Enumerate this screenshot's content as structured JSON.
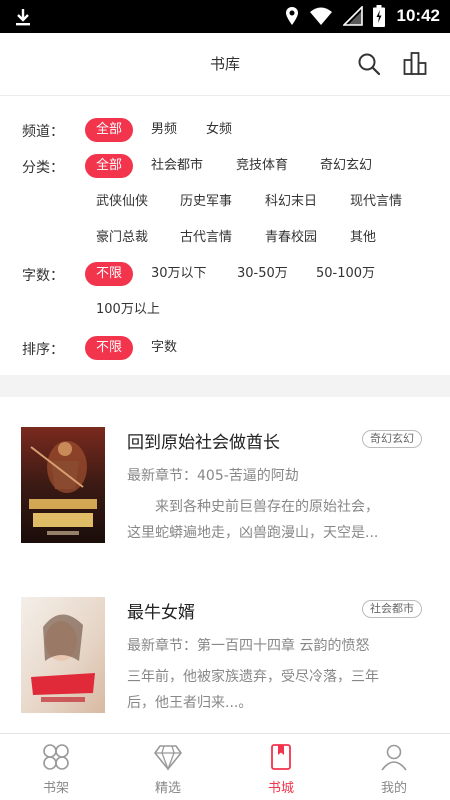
{
  "status_bar": {
    "time": "10:42",
    "icons": [
      "download-icon",
      "location-icon",
      "wifi-icon",
      "signal-icon",
      "battery-icon"
    ]
  },
  "header": {
    "title": "书库",
    "icons": [
      "search-icon",
      "ranking-icon"
    ]
  },
  "filters": {
    "channel": {
      "label": "频道：",
      "options": [
        "全部",
        "男频",
        "女频"
      ],
      "selected": "全部"
    },
    "category": {
      "label": "分类：",
      "options": [
        "全部",
        "社会都市",
        "竞技体育",
        "奇幻玄幻",
        "武侠仙侠",
        "历史军事",
        "科幻末日",
        "现代言情",
        "豪门总裁",
        "古代言情",
        "青春校园",
        "其他"
      ],
      "selected": "全部"
    },
    "word_count": {
      "label": "字数：",
      "options": [
        "不限",
        "30万以下",
        "30-50万",
        "50-100万",
        "100万以上"
      ],
      "selected": "不限"
    },
    "sort": {
      "label": "排序：",
      "options": [
        "不限",
        "字数"
      ],
      "selected": "不限"
    }
  },
  "books": [
    {
      "title": "回到原始社会做酋长",
      "tag": "奇幻玄幻",
      "latest_chapter": "最新章节：405-苦逼的阿劫",
      "desc_line1": "　　来到各种史前巨兽存在的原始社会，",
      "desc_line2": "这里蛇蟒遍地走，凶兽跑漫山，天空是..."
    },
    {
      "title": "最牛女婿",
      "tag": "社会都市",
      "latest_chapter": "最新章节：第一百四十四章 云韵的愤怒",
      "desc_line1": "三年前，他被家族遗弃，受尽冷落，三年",
      "desc_line2": "后，他王者归来...。"
    }
  ],
  "tabbar": {
    "items": [
      {
        "label": "书架",
        "icon": "grid-petal-icon"
      },
      {
        "label": "精选",
        "icon": "diamond-icon"
      },
      {
        "label": "书城",
        "icon": "book-icon"
      },
      {
        "label": "我的",
        "icon": "user-icon"
      }
    ],
    "active": "书城"
  },
  "colors": {
    "accent": "#f2344d",
    "text": "#333333",
    "muted": "#888888",
    "divider": "#f3f3f3",
    "statusbar": "#000000"
  }
}
